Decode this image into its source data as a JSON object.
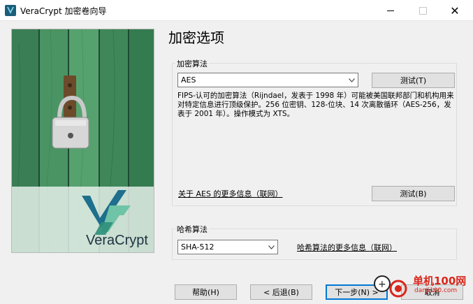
{
  "window": {
    "title": "VeraCrypt 加密卷向导",
    "close_glyph": "✕"
  },
  "page": {
    "heading": "加密选项"
  },
  "banner": {
    "brand_text": "VeraCrypt"
  },
  "encryption": {
    "group_label": "加密算法",
    "selected_algorithm": "AES",
    "test_button_1": "测试(T)",
    "description": "FIPS-认可的加密算法（Rijndael，发表于 1998 年）可能被美国联邦部门和机构用来对特定信息进行顶级保护。256 位密钥、128-位块、14 次离散循环（AES-256，发表于 2001 年）。操作模式为 XTS。",
    "more_info_link": "关于 AES 的更多信息（联网）",
    "test_button_2": "测试(B)"
  },
  "hash": {
    "group_label": "哈希算法",
    "selected_hash": "SHA-512",
    "more_info_link": "哈希算法的更多信息（联网）"
  },
  "footer": {
    "help_button": "帮助(H)",
    "back_button": "< 后退(B)",
    "next_button": "下一步(N) >",
    "cancel_button": "取消"
  },
  "watermark": {
    "site_name": "单机100网",
    "site_url": "danji100.com"
  },
  "colors": {
    "accent_blue": "#0078d7",
    "wood_green": "#3f8a5e",
    "watermark_red": "#d9261c"
  }
}
